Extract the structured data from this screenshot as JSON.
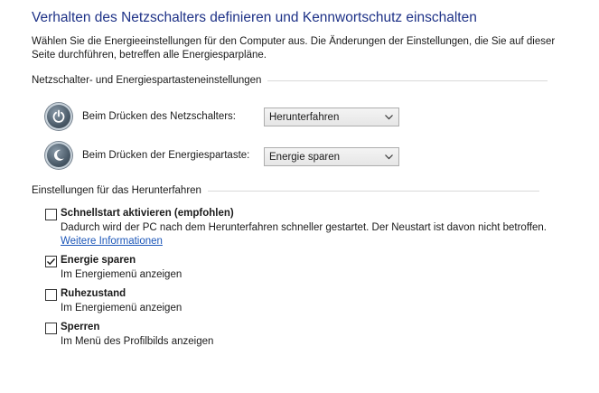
{
  "page": {
    "title": "Verhalten des Netzschalters definieren und Kennwortschutz einschalten",
    "description": "Wählen Sie die Energieeinstellungen für den Computer aus. Die Änderungen der Einstellungen, die Sie auf dieser Seite durchführen, betreffen alle Energiesparpläne."
  },
  "buttons_section": {
    "header": "Netzschalter- und Energiespartasteneinstellungen",
    "power_button": {
      "label": "Beim Drücken des Netzschalters:",
      "value": "Herunterfahren"
    },
    "sleep_button": {
      "label": "Beim Drücken der Energiespartaste:",
      "value": "Energie sparen"
    }
  },
  "shutdown_section": {
    "header": "Einstellungen für das Herunterfahren",
    "options": [
      {
        "title": "Schnellstart aktivieren (empfohlen)",
        "desc": "Dadurch wird der PC nach dem Herunterfahren schneller gestartet. Der Neustart ist davon nicht betroffen.",
        "link": "Weitere Informationen",
        "checked": false
      },
      {
        "title": "Energie sparen",
        "desc": "Im Energiemenü anzeigen",
        "checked": true
      },
      {
        "title": "Ruhezustand",
        "desc": "Im Energiemenü anzeigen",
        "checked": false
      },
      {
        "title": "Sperren",
        "desc": "Im Menü des Profilbilds anzeigen",
        "checked": false
      }
    ]
  },
  "colors": {
    "title": "#1e3287",
    "link": "#1a55b8"
  }
}
